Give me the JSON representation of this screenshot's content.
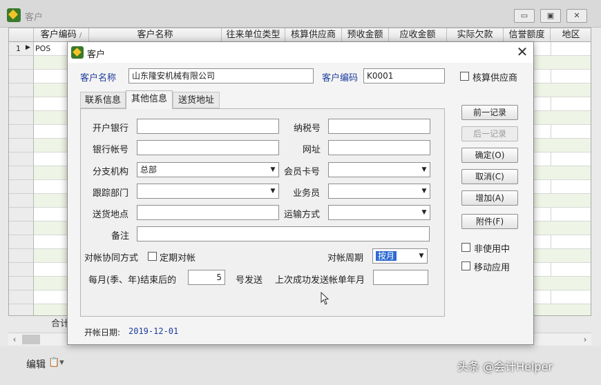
{
  "background_window": {
    "title": "客户",
    "columns": [
      "客户编码",
      "客户名称",
      "往来单位类型",
      "核算供应商",
      "预收金额",
      "应收金额",
      "实际欠款",
      "信誉额度",
      "地区"
    ],
    "sort_indicator": "/",
    "rows": [
      {
        "row_number": "1",
        "pointer": "▶",
        "code": "POS"
      }
    ],
    "total_label": "合计",
    "bottom_edit_label": "编辑",
    "watermark": "头条 @会计Helper"
  },
  "dialog": {
    "title": "客户",
    "header": {
      "name_label": "客户名称",
      "name_value": "山东隆安机械有限公司",
      "code_label": "客户编码",
      "code_value": "K0001",
      "check_supplier_label": "核算供应商",
      "check_supplier_checked": false
    },
    "tabs": [
      {
        "label": "联系信息",
        "active": false
      },
      {
        "label": "其他信息",
        "active": true
      },
      {
        "label": "送货地址",
        "active": false
      }
    ],
    "fields": {
      "bank_label": "开户银行",
      "bank_value": "",
      "tax_label": "纳税号",
      "tax_value": "",
      "account_label": "银行帐号",
      "account_value": "",
      "website_label": "网址",
      "website_value": "",
      "branch_label": "分支机构",
      "branch_value": "总部",
      "member_card_label": "会员卡号",
      "member_card_value": "",
      "dept_label": "跟踪部门",
      "dept_value": "",
      "salesman_label": "业务员",
      "salesman_value": "",
      "delivery_label": "送货地点",
      "delivery_value": "",
      "transport_label": "运输方式",
      "transport_value": "",
      "remark_label": "备注",
      "remark_value": "",
      "reconcile_label": "对帐协同方式",
      "periodic_label": "定期对帐",
      "periodic_checked": false,
      "period_label": "对帐周期",
      "period_value": "按月",
      "monthly_prefix": "每月(季、年)结束后的",
      "monthly_days": "5",
      "monthly_suffix": "号发送",
      "last_sent_label": "上次成功发送帐单年月",
      "last_sent_value": ""
    },
    "buttons": {
      "prev": "前一记录",
      "next": "后一记录",
      "ok": "确定(O)",
      "cancel": "取消(C)",
      "add": "增加(A)",
      "attach": "附件(F)"
    },
    "side_checks": {
      "inactive_label": "非使用中",
      "inactive_checked": false,
      "mobile_label": "移动应用",
      "mobile_checked": false
    },
    "open_date_label": "开帐日期:",
    "open_date_value": "2019-12-01"
  },
  "colors": {
    "label_blue": "#1e3c9c",
    "row_alt_green": "#eef5e6",
    "selection_blue": "#2e6ad1"
  }
}
